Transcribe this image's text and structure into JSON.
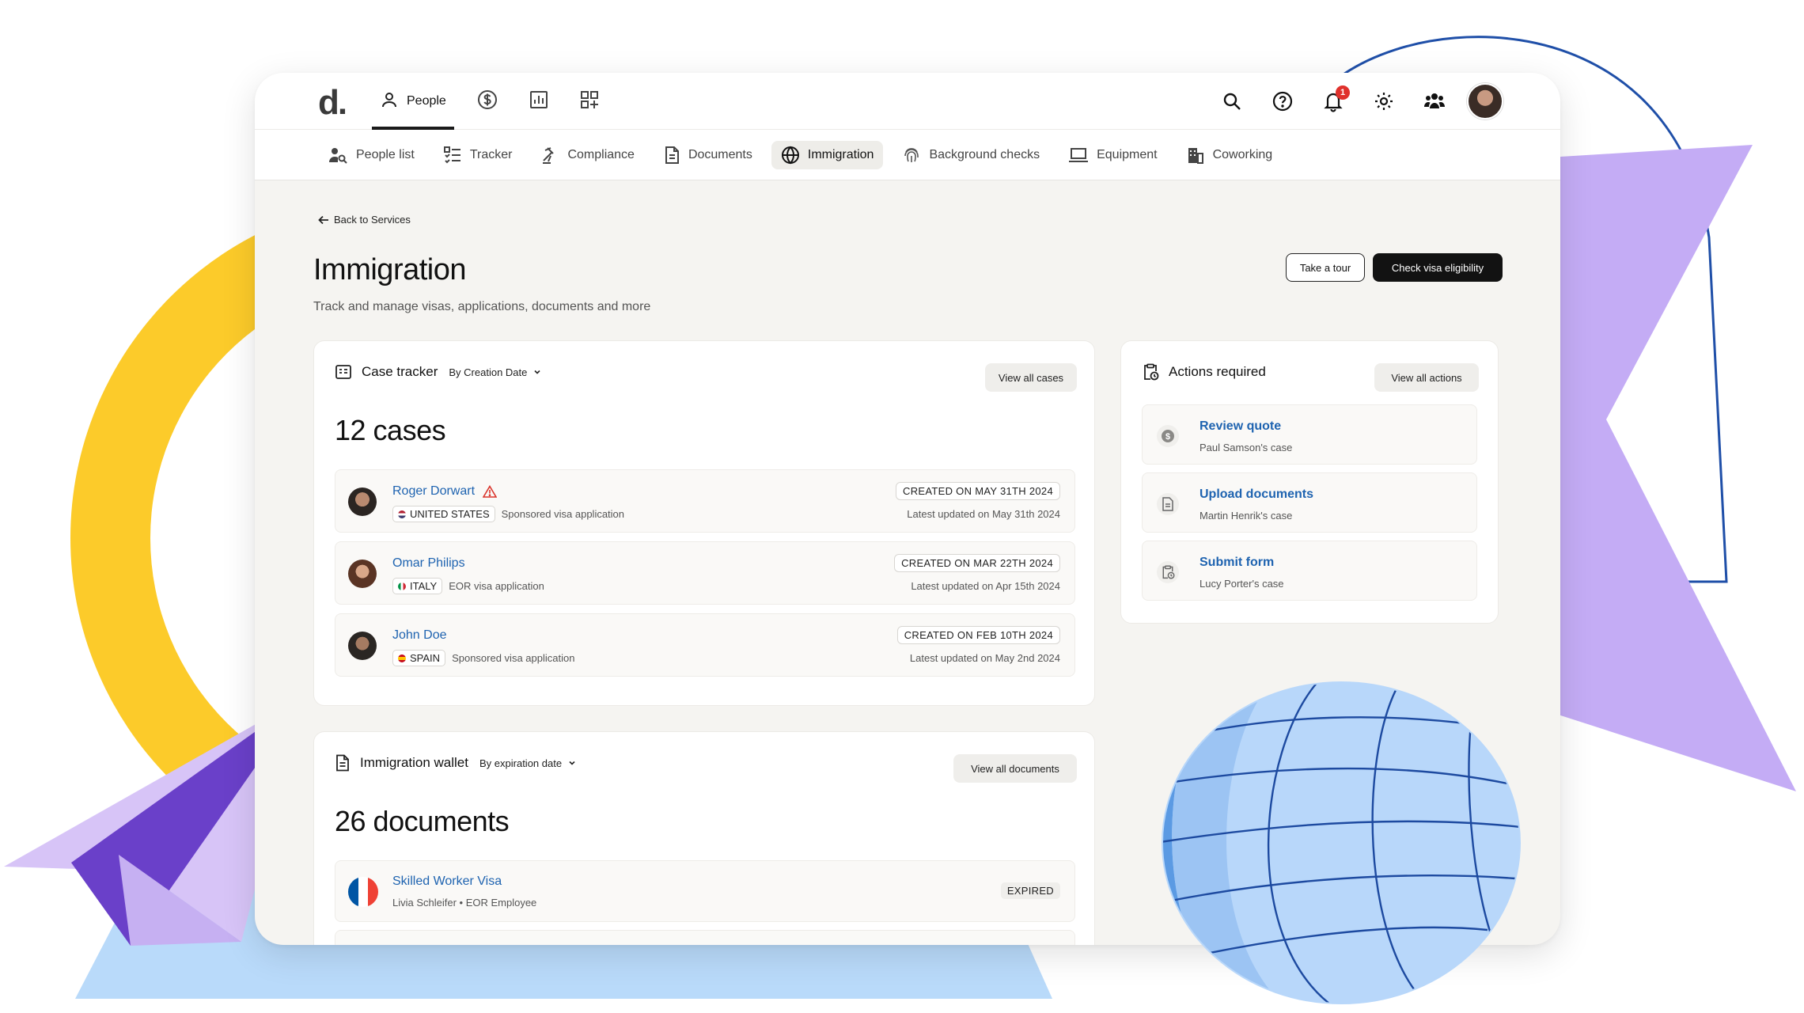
{
  "brand": {
    "logo": "d."
  },
  "top_nav": [
    {
      "label": "People",
      "icon": "person-icon",
      "active": true
    },
    {
      "label": "",
      "icon": "dollar-icon"
    },
    {
      "label": "",
      "icon": "analytics-icon"
    },
    {
      "label": "",
      "icon": "apps-add-icon"
    }
  ],
  "notifications": {
    "count": "1"
  },
  "sub_nav": [
    {
      "label": "People list",
      "icon": "people-search-icon"
    },
    {
      "label": "Tracker",
      "icon": "checklist-icon"
    },
    {
      "label": "Compliance",
      "icon": "gavel-icon"
    },
    {
      "label": "Documents",
      "icon": "document-icon"
    },
    {
      "label": "Immigration",
      "icon": "globe-icon",
      "active": true
    },
    {
      "label": "Background checks",
      "icon": "fingerprint-icon"
    },
    {
      "label": "Equipment",
      "icon": "laptop-icon"
    },
    {
      "label": "Coworking",
      "icon": "building-icon"
    }
  ],
  "page": {
    "back_label": "Back to Services",
    "title": "Immigration",
    "subtitle": "Track and manage visas, applications, documents and more",
    "tour_button": "Take a tour",
    "eligibility_button": "Check visa eligibility"
  },
  "case_tracker": {
    "title": "Case tracker",
    "sort_label": "By Creation Date",
    "view_all": "View all cases",
    "count_label": "12 cases",
    "cases": [
      {
        "name": "Roger Dorwart",
        "warning": true,
        "country": "UNITED STATES",
        "type": "Sponsored visa application",
        "created": "CREATED ON MAY 31TH 2024",
        "updated": "Latest updated on May 31th 2024"
      },
      {
        "name": "Omar Philips",
        "warning": false,
        "country": "ITALY",
        "type": "EOR visa application",
        "created": "CREATED ON MAR 22TH 2024",
        "updated": "Latest updated on Apr 15th 2024"
      },
      {
        "name": "John Doe",
        "warning": false,
        "country": "SPAIN",
        "type": "Sponsored visa application",
        "created": "CREATED ON FEB 10TH 2024",
        "updated": "Latest updated on May 2nd 2024"
      }
    ]
  },
  "actions": {
    "title": "Actions required",
    "view_all": "View all actions",
    "items": [
      {
        "title": "Review quote",
        "subtitle": "Paul Samson's case",
        "icon": "dollar-coin-icon"
      },
      {
        "title": "Upload documents",
        "subtitle": "Martin Henrik's case",
        "icon": "document-icon"
      },
      {
        "title": "Submit form",
        "subtitle": "Lucy Porter's case",
        "icon": "clipboard-clock-icon"
      }
    ]
  },
  "wallet": {
    "title": "Immigration wallet",
    "sort_label": "By expiration date",
    "view_all": "View all documents",
    "count_label": "26 documents",
    "documents": [
      {
        "name": "Skilled Worker Visa",
        "meta": "Livia Schleifer • EOR Employee",
        "status": "EXPIRED"
      }
    ]
  },
  "colors": {
    "link": "#1e63b0",
    "yellow": "#fccb2a",
    "purple": "#c4acf5",
    "light_blue": "#b9dafa",
    "dark_button": "#121212",
    "badge": "#e0312c"
  }
}
